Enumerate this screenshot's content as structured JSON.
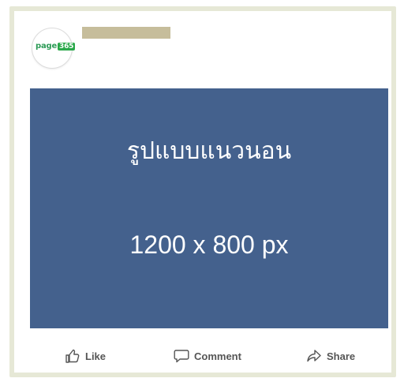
{
  "post": {
    "page_logo": {
      "word": "page",
      "number": "365"
    },
    "image": {
      "title": "รูปแบบแนวนอน",
      "size": "1200 x 800 px",
      "background_color": "#44618d"
    },
    "actions": {
      "like": "Like",
      "comment": "Comment",
      "share": "Share"
    }
  }
}
